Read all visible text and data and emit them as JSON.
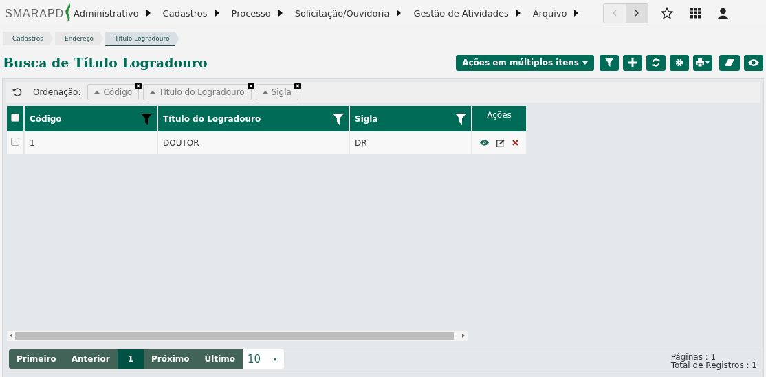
{
  "logo": {
    "text": "SMARAPD"
  },
  "nav": {
    "menus": [
      "Administrativo",
      "Cadastros",
      "Processo",
      "Solicitação/Ouvidoria",
      "Gestão de Atividades",
      "Arquivo"
    ],
    "prev_disabled": true,
    "next_disabled": false
  },
  "breadcrumb": [
    {
      "label": "Cadastros",
      "selected": false
    },
    {
      "label": "Endereço",
      "selected": false
    },
    {
      "label": "Título Logradouro",
      "selected": true
    }
  ],
  "page_title": "Busca de Título Logradouro",
  "toolbar": {
    "bulk_actions": "Ações em múltiplos itens",
    "buttons": [
      {
        "kind": "filter"
      },
      {
        "kind": "plus"
      },
      {
        "kind": "refresh"
      },
      {
        "kind": "gear"
      },
      {
        "kind": "print"
      },
      {
        "kind": "eraser"
      },
      {
        "kind": "eye"
      }
    ]
  },
  "sort": {
    "label": "Ordenação:",
    "items": [
      "Código",
      "Título do Logradouro",
      "Sigla"
    ]
  },
  "table": {
    "select_all_checked": false,
    "columns": [
      {
        "label": "Código",
        "filter_active": true
      },
      {
        "label": "Título do Logradouro",
        "filter_active": false
      },
      {
        "label": "Sigla",
        "filter_active": false
      }
    ],
    "actions_label": "Ações",
    "rows": [
      {
        "checked": false,
        "cells": [
          "1",
          "DOUTOR",
          "DR"
        ]
      }
    ]
  },
  "pagination": {
    "items": [
      {
        "label": "Primeiro",
        "selected": false
      },
      {
        "label": "Anterior",
        "selected": false
      },
      {
        "label": "1",
        "selected": true
      },
      {
        "label": "Próximo",
        "selected": false
      },
      {
        "label": "Último",
        "selected": false
      }
    ],
    "page_size": "10"
  },
  "summary": {
    "pages": "Páginas : 1",
    "total": "Total de Registros : 1"
  }
}
